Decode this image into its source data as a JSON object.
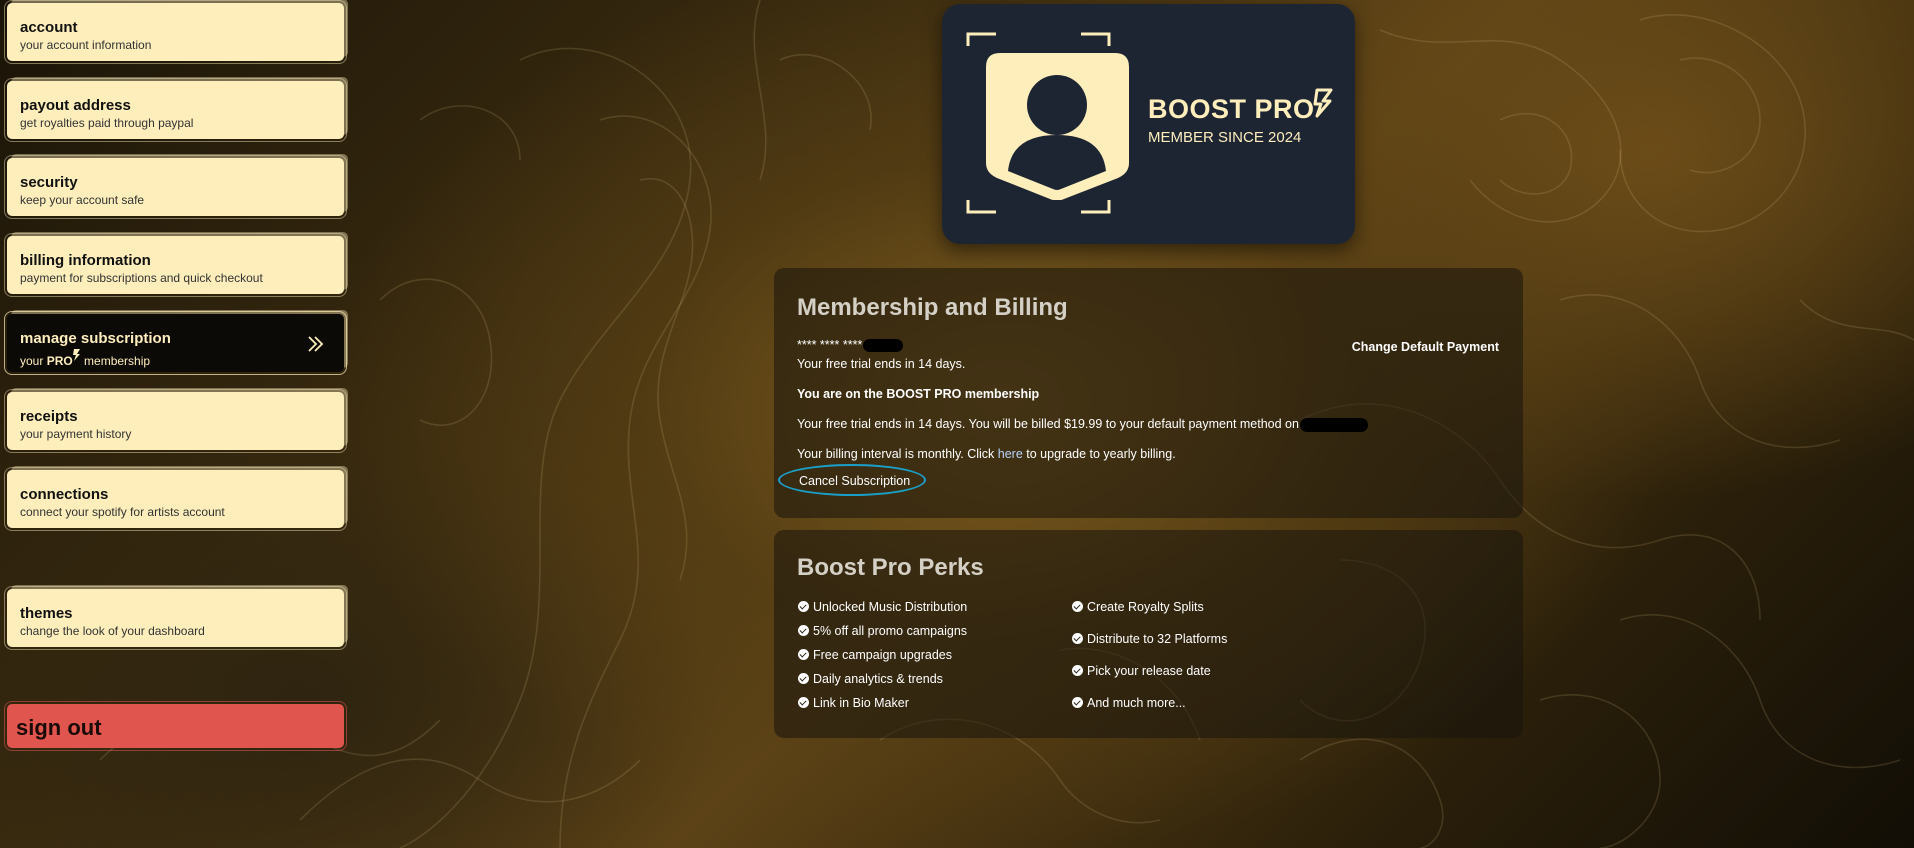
{
  "sidebar": {
    "items": [
      {
        "title": "account",
        "sub": "your account information"
      },
      {
        "title": "payout address",
        "sub": "get royalties paid through paypal"
      },
      {
        "title": "security",
        "sub": "keep your account safe"
      },
      {
        "title": "billing information",
        "sub": "payment for subscriptions and quick checkout"
      },
      {
        "title": "manage subscription",
        "sub_prefix": "your ",
        "sub_pro": "PRO",
        "sub_suffix": " membership"
      },
      {
        "title": "receipts",
        "sub": "your payment history"
      },
      {
        "title": "connections",
        "sub": "connect your spotify for artists account"
      },
      {
        "title": "themes",
        "sub": "change the look of your dashboard"
      }
    ],
    "signout": "sign out"
  },
  "card": {
    "brand": "BOOST PRO",
    "since": "MEMBER SINCE 2024"
  },
  "billing": {
    "title": "Membership and Billing",
    "masked_card": "**** **** ****",
    "change_payment": "Change Default Payment",
    "trial_short": "Your free trial ends in 14 days.",
    "membership_prefix": "You are on the ",
    "membership_name": "BOOST PRO",
    "membership_suffix": " membership",
    "billed_text": "Your free trial ends in 14 days. You will be billed $19.99 to your default payment method on",
    "interval_prefix": "Your billing interval is monthly. Click ",
    "interval_link": "here",
    "interval_suffix": " to upgrade to yearly billing.",
    "cancel": "Cancel Subscription"
  },
  "perks": {
    "title": "Boost Pro Perks",
    "left": [
      "Unlocked Music Distribution",
      "5% off all promo campaigns",
      "Free campaign upgrades",
      "Daily analytics & trends",
      "Link in Bio Maker"
    ],
    "right": [
      "Create Royalty Splits",
      "Distribute to 32 Platforms",
      "Pick your release date",
      "And much more..."
    ]
  },
  "colors": {
    "cream": "#fdeebc",
    "card_bg": "#1d2533",
    "signout": "#e0564e",
    "cancel_ring": "#1aa0c8"
  }
}
